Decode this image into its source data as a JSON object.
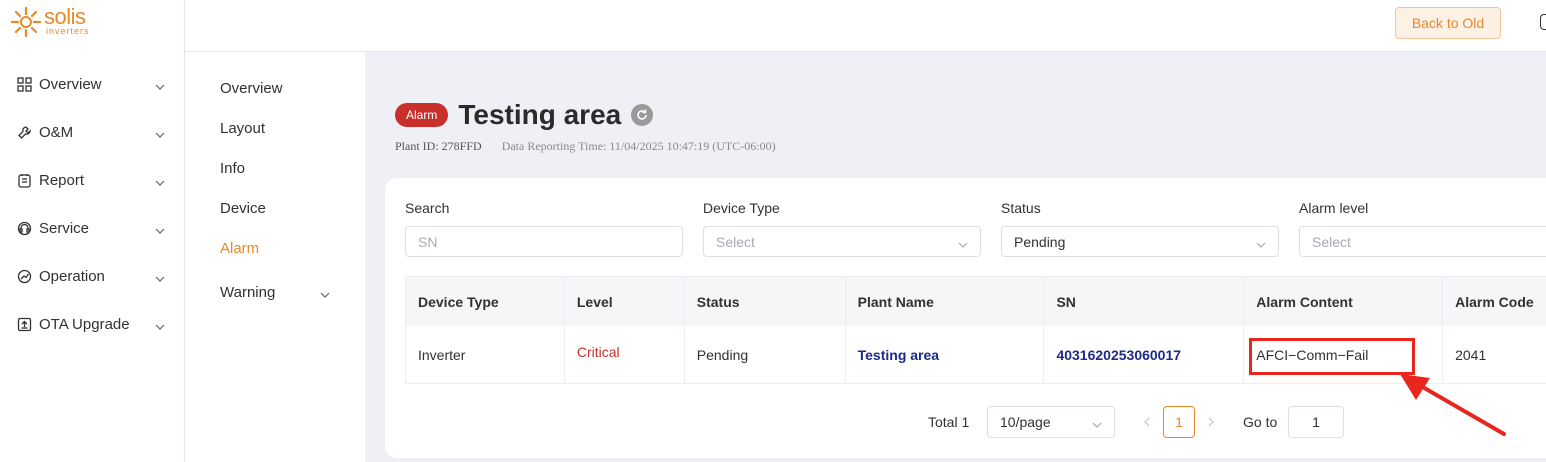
{
  "brand": {
    "name": "solis",
    "sub": "inverters",
    "color": "#e8892a"
  },
  "topbar": {
    "back_label": "Back to Old"
  },
  "nav": {
    "items": [
      {
        "label": "Overview",
        "icon": "grid-icon"
      },
      {
        "label": "O&M",
        "icon": "wrench-icon"
      },
      {
        "label": "Report",
        "icon": "report-icon"
      },
      {
        "label": "Service",
        "icon": "headset-icon"
      },
      {
        "label": "Operation",
        "icon": "gauge-icon"
      },
      {
        "label": "OTA Upgrade",
        "icon": "upload-icon"
      }
    ]
  },
  "subnav": {
    "items": [
      {
        "label": "Overview"
      },
      {
        "label": "Layout"
      },
      {
        "label": "Info"
      },
      {
        "label": "Device"
      },
      {
        "label": "Alarm"
      },
      {
        "label": "Warning"
      }
    ],
    "active": "Alarm"
  },
  "page": {
    "tag": "Alarm",
    "title": "Testing area",
    "plant_id": "Plant ID: 278FFD",
    "reporting_time": "Data Reporting Time: 11/04/2025 10:47:19 (UTC-06:00)"
  },
  "filters": {
    "search": {
      "label": "Search",
      "placeholder": "SN"
    },
    "device_type": {
      "label": "Device Type",
      "placeholder": "Select"
    },
    "status": {
      "label": "Status",
      "value": "Pending"
    },
    "alarm_level": {
      "label": "Alarm level",
      "placeholder": "Select"
    }
  },
  "table": {
    "headers": [
      "Device Type",
      "Level",
      "Status",
      "Plant Name",
      "SN",
      "Alarm Content",
      "Alarm Code"
    ],
    "rows": [
      {
        "device_type": "Inverter",
        "level": "Critical",
        "status": "Pending",
        "plant_name": "Testing area",
        "sn": "4031620253060017",
        "alarm_content": "AFCI−Comm−Fail",
        "alarm_code": "2041"
      }
    ]
  },
  "pagination": {
    "total": "Total 1",
    "page_size": "10/page",
    "current": "1",
    "goto_label": "Go to",
    "goto_value": "1"
  },
  "colors": {
    "accent": "#e8892a",
    "critical": "#c9302c",
    "link": "#1c2a8a",
    "highlight": "#e8261d"
  }
}
